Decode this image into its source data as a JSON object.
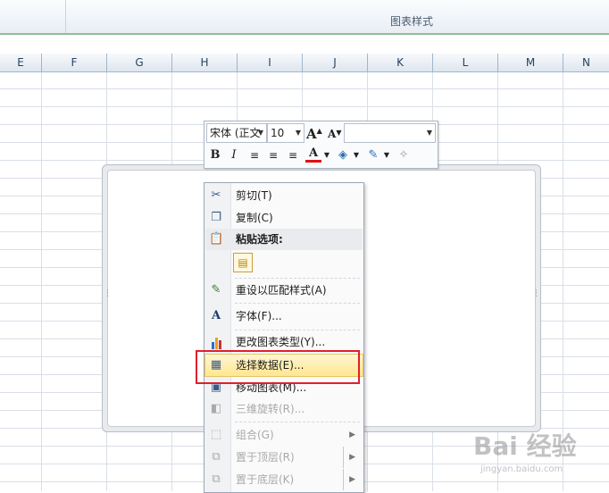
{
  "ribbon": {
    "group_label": "图表样式"
  },
  "columns": [
    "E",
    "F",
    "G",
    "H",
    "I",
    "J",
    "K",
    "L",
    "M",
    "N"
  ],
  "mini_toolbar": {
    "font_name": "宋体 (正文",
    "font_size": "10",
    "grow_font": "A",
    "shrink_font": "A",
    "style_box": "",
    "bold": "B",
    "italic": "I",
    "font_color_glyph": "A"
  },
  "context_menu": {
    "items": [
      {
        "label": "剪切(T)",
        "icon": "scissors-icon",
        "disabled": false
      },
      {
        "label": "复制(C)",
        "icon": "copy-icon",
        "disabled": false
      },
      {
        "label": "粘贴选项:",
        "icon": "clipboard-icon",
        "disabled": false,
        "header": true
      },
      {
        "label": "重设以匹配样式(A)",
        "icon": "reset-style-icon",
        "disabled": false
      },
      {
        "label": "字体(F)...",
        "icon": "font-icon",
        "disabled": false
      },
      {
        "label": "更改图表类型(Y)...",
        "icon": "chart-type-icon",
        "disabled": false
      },
      {
        "label": "选择数据(E)...",
        "icon": "select-data-icon",
        "disabled": false,
        "highlighted": true
      },
      {
        "label": "移动图表(M)...",
        "icon": "move-chart-icon",
        "disabled": false
      },
      {
        "label": "三维旋转(R)...",
        "icon": "rotate-3d-icon",
        "disabled": true
      },
      {
        "label": "组合(G)",
        "icon": "group-icon",
        "disabled": true,
        "submenu": true
      },
      {
        "label": "置于顶层(R)",
        "icon": "bring-front-icon",
        "disabled": true,
        "submenu": true
      },
      {
        "label": "置于底层(K)",
        "icon": "send-back-icon",
        "disabled": true,
        "submenu": true
      }
    ]
  },
  "watermark": {
    "brand": "Bai 经验",
    "url": "jingyan.baidu.com"
  },
  "colors": {
    "highlight_border": "#e0202a",
    "menu_hover": "#ffe68f"
  }
}
